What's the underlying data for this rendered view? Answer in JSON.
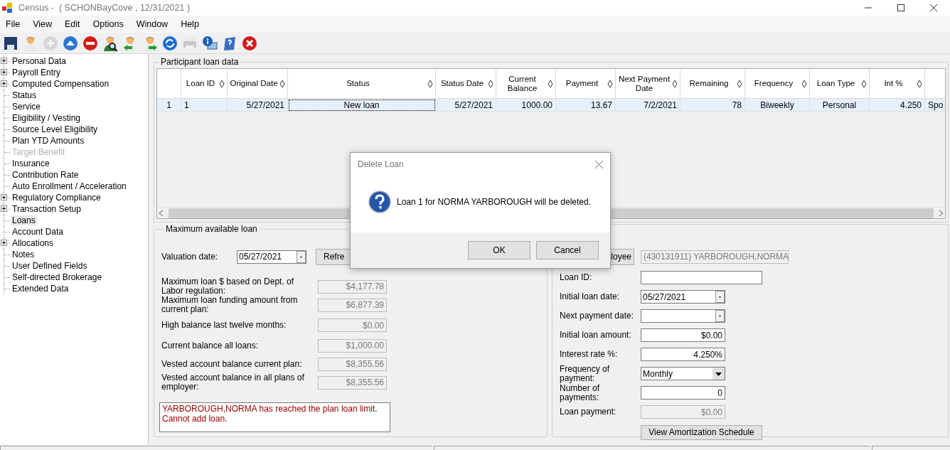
{
  "window": {
    "title": "Census -  ( SCHONBayCove , 12/31/2021 )"
  },
  "menu": [
    "File",
    "View",
    "Edit",
    "Options",
    "Window",
    "Help"
  ],
  "toolbar": [
    {
      "kind": "save",
      "disabled": false
    },
    {
      "kind": "person",
      "disabled": false
    },
    {
      "kind": "add",
      "disabled": true
    },
    {
      "kind": "up",
      "disabled": false
    },
    {
      "kind": "remove",
      "disabled": false
    },
    {
      "kind": "find",
      "disabled": false
    },
    {
      "kind": "prev",
      "disabled": false
    },
    {
      "kind": "next",
      "disabled": false
    },
    {
      "kind": "refresh",
      "disabled": false
    },
    {
      "kind": "print",
      "disabled": true
    },
    {
      "kind": "info",
      "disabled": false
    },
    {
      "kind": "help",
      "disabled": false
    },
    {
      "kind": "close",
      "disabled": false
    }
  ],
  "sidebar": {
    "items": [
      {
        "label": "Personal Data",
        "kind": "group",
        "selected": false,
        "disabled": false
      },
      {
        "label": "Payroll Entry",
        "kind": "group",
        "selected": false,
        "disabled": false
      },
      {
        "label": "Computed Compensation",
        "kind": "group",
        "selected": false,
        "disabled": false
      },
      {
        "label": "Status",
        "kind": "leaf",
        "selected": false,
        "disabled": false
      },
      {
        "label": "Service",
        "kind": "leaf",
        "selected": false,
        "disabled": false
      },
      {
        "label": "Eligibility / Vesting",
        "kind": "leaf",
        "selected": false,
        "disabled": false
      },
      {
        "label": "Source Level Eligibility",
        "kind": "leaf",
        "selected": false,
        "disabled": false
      },
      {
        "label": "Plan YTD Amounts",
        "kind": "leaf",
        "selected": false,
        "disabled": false
      },
      {
        "label": "Target Benefit",
        "kind": "leaf",
        "selected": false,
        "disabled": true
      },
      {
        "label": "Insurance",
        "kind": "leaf",
        "selected": false,
        "disabled": false
      },
      {
        "label": "Contribution Rate",
        "kind": "leaf",
        "selected": false,
        "disabled": false
      },
      {
        "label": "Auto Enrollment / Acceleration",
        "kind": "leaf",
        "selected": false,
        "disabled": false
      },
      {
        "label": "Regulatory Compliance",
        "kind": "group",
        "selected": false,
        "disabled": false
      },
      {
        "label": "Transaction Setup",
        "kind": "group",
        "selected": false,
        "disabled": false
      },
      {
        "label": "Loans",
        "kind": "leaf",
        "selected": true,
        "disabled": false
      },
      {
        "label": "Account Data",
        "kind": "leaf",
        "selected": false,
        "disabled": false
      },
      {
        "label": "Allocations",
        "kind": "group",
        "selected": false,
        "disabled": false
      },
      {
        "label": "Notes",
        "kind": "leaf",
        "selected": false,
        "disabled": false
      },
      {
        "label": "User Defined Fields",
        "kind": "leaf",
        "selected": false,
        "disabled": false
      },
      {
        "label": "Self-directed Brokerage",
        "kind": "leaf",
        "selected": false,
        "disabled": false
      },
      {
        "label": "Extended Data",
        "kind": "leaf",
        "selected": false,
        "disabled": false
      }
    ]
  },
  "loan_grid": {
    "title": "Participant loan data",
    "columns": [
      "Loan ID",
      "Original Date",
      "Status",
      "Status Date",
      "Current Balance",
      "Payment",
      "Next Payment Date",
      "Remaining",
      "Frequency",
      "Loan Type",
      "Int %"
    ],
    "rows": [
      {
        "row_header": "1",
        "selected": true,
        "cells": [
          "1",
          "5/27/2021",
          "New loan",
          "5/27/2021",
          "1000.00",
          "13.67",
          "7/2/2021",
          "78",
          "Biweekly",
          "Personal",
          "4.250",
          "Spo"
        ]
      }
    ]
  },
  "max_loan": {
    "title": "Maximum available loan",
    "valuation_label": "Valuation date:",
    "valuation_date": "05/27/2021",
    "refresh_button": "Refre",
    "fields": [
      {
        "label": "Maximum loan $ based on Dept. of Labor regulation:",
        "value": "$4,177.78"
      },
      {
        "label": "Maximum loan funding amount from current plan:",
        "value": "$6,877.39"
      },
      {
        "label": "High balance last twelve months:",
        "value": "$0.00"
      },
      {
        "label": "Current balance all loans:",
        "value": "$1,000.00"
      },
      {
        "label": "Vested account balance current plan:",
        "value": "$8,355.56"
      },
      {
        "label": "Vested account balance in all plans of employer:",
        "value": "$8,355.56"
      }
    ],
    "message": [
      "YARBOROUGH,NORMA has reached the plan loan limit.",
      "Cannot add loan."
    ]
  },
  "loan_entry": {
    "employee_button": "loyee",
    "employee": "(430131911) YARBOROUGH,NORMA",
    "fields": [
      {
        "label": "Loan ID:",
        "kind": "text"
      },
      {
        "label": "Initial loan date:",
        "kind": "date",
        "value": "05/27/2021"
      },
      {
        "label": "Next payment date:",
        "kind": "date"
      },
      {
        "label": "Initial loan amount:",
        "kind": "amount",
        "value": "$0.00"
      },
      {
        "label": "Interest rate %:",
        "kind": "amount",
        "value": "4.250%"
      },
      {
        "label": "Frequency of payment:",
        "kind": "combo",
        "value": "Monthly"
      },
      {
        "label": "Number of payments:",
        "kind": "amount",
        "value": "0"
      },
      {
        "label": "Loan payment:",
        "kind": "readonly",
        "value": "$0.00"
      }
    ],
    "schedule_button": "View Amortization Schedule"
  },
  "dialog": {
    "title": "Delete Loan",
    "message": "Loan 1 for NORMA YARBOROUGH will be deleted.",
    "buttons": [
      "OK",
      "Cancel"
    ]
  }
}
